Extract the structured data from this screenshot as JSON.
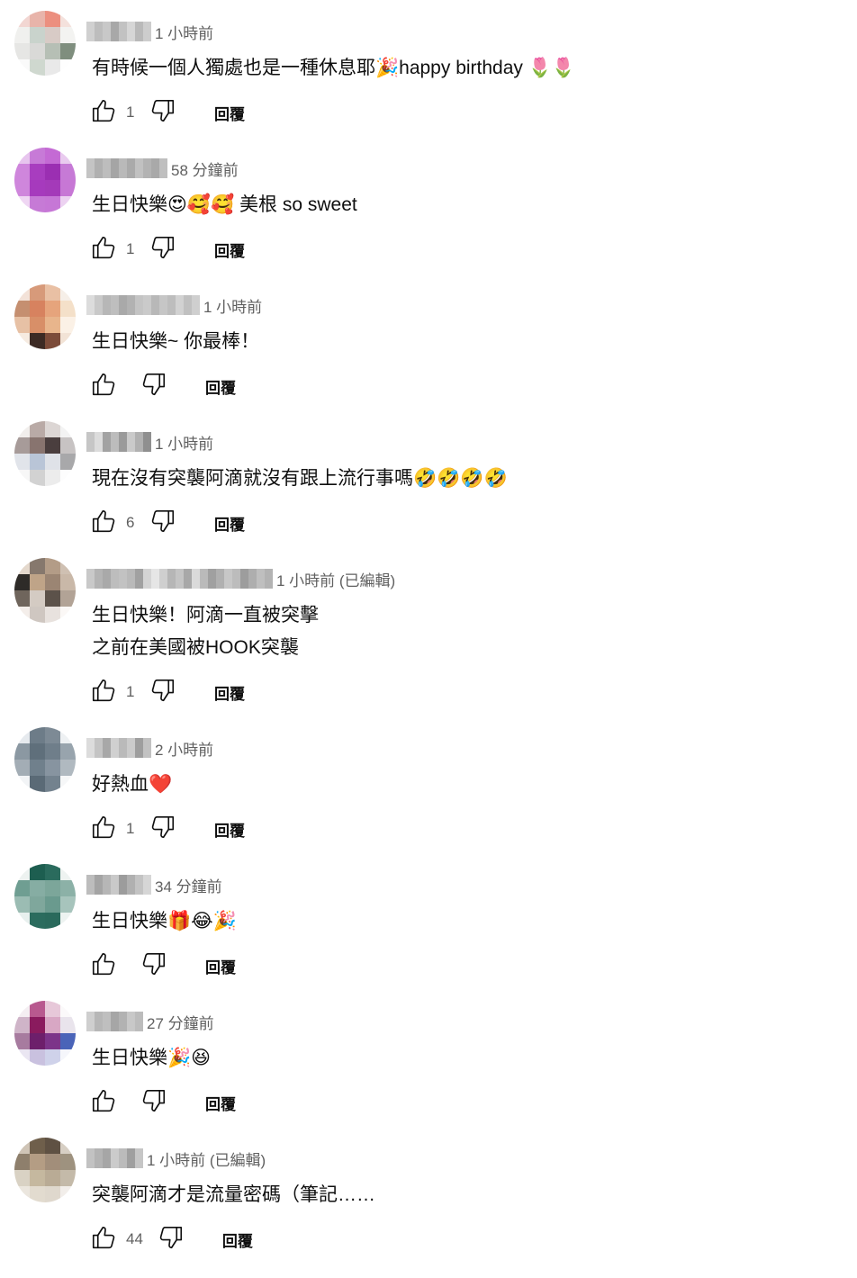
{
  "reply_label": "回覆",
  "comments": [
    {
      "time": "1 小時前",
      "text": "有時候一個人獨處也是一種休息耶🎉happy birthday 🌷🌷",
      "likes": "1",
      "avatar": [
        "#f2d6d2",
        "#e8b4aa",
        "#ec8f7f",
        "#f4e1dc",
        "#f0f0ee",
        "#c9d3cc",
        "#d8cbc6",
        "#f3f3f1",
        "#e6e6e4",
        "#d9d9d7",
        "#b6bfb5",
        "#7f8e7e",
        "#fafafa",
        "#cfd8cf",
        "#e9e9e9",
        "#fefefe"
      ],
      "name": [
        "#d0d0d0",
        "#bdbdbd",
        "#c8c8c8",
        "#a8a8a8",
        "#c2c2c2",
        "#d6d6d6",
        "#b9b9b9",
        "#cdcdcd"
      ]
    },
    {
      "time": "58 分鐘前",
      "text": "生日快樂😍🥰🥰 美根 so sweet",
      "likes": "1",
      "avatar": [
        "#e7c5ee",
        "#c77ad7",
        "#c46ad4",
        "#e9cbef",
        "#cf86dc",
        "#a83dbf",
        "#9b2fb2",
        "#c67ad6",
        "#cf86dc",
        "#a63abd",
        "#a43ab9",
        "#c777d5",
        "#efd6f3",
        "#c67ad6",
        "#c677d6",
        "#ecd2f1"
      ],
      "name": [
        "#c4c4c4",
        "#b0b0b0",
        "#bdbdbd",
        "#a5a5a5",
        "#b9b9b9",
        "#aaaaaa",
        "#c1c1c1",
        "#b3b3b3",
        "#a9a9a9",
        "#bfbfbf"
      ]
    },
    {
      "time": "1 小時前",
      "text": "生日快樂~ 你最棒！",
      "likes": "",
      "avatar": [
        "#f3e2d8",
        "#d79a7a",
        "#e9c0a4",
        "#f6efe8",
        "#c58f70",
        "#d7825f",
        "#e6a47c",
        "#f4e0c9",
        "#e7c1a5",
        "#d88f68",
        "#e8b58c",
        "#fbf1e6",
        "#f6ebe1",
        "#3c2a24",
        "#7c4b39",
        "#f2e3d6"
      ],
      "name": [
        "#dcdcdc",
        "#c9c9c9",
        "#b7b7b7",
        "#bebebe",
        "#a9a9a9",
        "#b2b2b2",
        "#c4c4c4",
        "#cacaca",
        "#b8b8b8",
        "#c6c6c6",
        "#bdbdbd",
        "#d2d2d2",
        "#c0c0c0",
        "#cfcfcf"
      ]
    },
    {
      "time": "1 小時前",
      "text": "現在沒有突襲阿滴就沒有跟上流行事嗎🤣🤣🤣🤣",
      "likes": "6",
      "avatar": [
        "#f1eeec",
        "#b9aaa6",
        "#dcd6d4",
        "#f3f3f3",
        "#a79b99",
        "#88746f",
        "#4a3e3e",
        "#c7c3c3",
        "#e1e4ea",
        "#b9c5d7",
        "#dfe2e8",
        "#a8a8aa",
        "#f7f7f7",
        "#d2d2d2",
        "#ececec",
        "#fdfdfd"
      ],
      "name": [
        "#c6c6c6",
        "#dcdcdc",
        "#a2a2a2",
        "#bcbcbc",
        "#9a9a9a",
        "#cacaca",
        "#b1b1b1",
        "#8f8f8f"
      ]
    },
    {
      "time": "1 小時前 (已編輯)",
      "text": "生日快樂！阿滴一直被突擊\n之前在美國被HOOK突襲",
      "likes": "1",
      "avatar": [
        "#e4d8cc",
        "#86786d",
        "#b39c87",
        "#cfc0b2",
        "#2e2b28",
        "#bfa488",
        "#9b8573",
        "#c9b8a8",
        "#6f655c",
        "#d4cbc3",
        "#5c524a",
        "#b2a396",
        "#f4eeea",
        "#cfc7c1",
        "#e8e2de",
        "#fbf8f6"
      ],
      "name": [
        "#c9c9c9",
        "#b4b4b4",
        "#a9a9a9",
        "#bdbdbd",
        "#c2c2c2",
        "#b9b9b9",
        "#a1a1a1",
        "#d4d4d4",
        "#e6e6e6",
        "#cfcfcf",
        "#b6b6b6",
        "#c4c4c4",
        "#a8a8a8",
        "#dadada",
        "#bababa",
        "#a0a0a0",
        "#b0b0b0",
        "#c7c7c7",
        "#bcbcbc",
        "#9d9d9d",
        "#aeaeae",
        "#bfbfbf",
        "#b3b3b3"
      ]
    },
    {
      "time": "2 小時前",
      "text": "好熱血❤️",
      "likes": "1",
      "avatar": [
        "#e6eaee",
        "#6d7c88",
        "#7d8a95",
        "#eef1f3",
        "#8b98a2",
        "#5f6f7b",
        "#6f7e8a",
        "#98a4ad",
        "#a3adb5",
        "#70808c",
        "#8794a0",
        "#b0b9c0",
        "#f2f4f6",
        "#5a6a76",
        "#73828e",
        "#f6f7f8"
      ],
      "name": [
        "#dcdcdc",
        "#c4c4c4",
        "#a8a8a8",
        "#d0d0d0",
        "#bababa",
        "#cbcbcb",
        "#9e9e9e",
        "#c2c2c2"
      ]
    },
    {
      "time": "34 分鐘前",
      "text": "生日快樂🎁😂🎉",
      "likes": "",
      "avatar": [
        "#edf2f0",
        "#1d5e50",
        "#2a6b5d",
        "#eef3f1",
        "#6f9e92",
        "#86ada3",
        "#7ca69a",
        "#8cb1a7",
        "#9bbcb3",
        "#7fa79c",
        "#6a9a8e",
        "#a7c4bc",
        "#e8f0ee",
        "#2b6c5e",
        "#2a6a5c",
        "#edf3f1"
      ],
      "name": [
        "#bdbdbd",
        "#a4a4a4",
        "#b6b6b6",
        "#c9c9c9",
        "#9c9c9c",
        "#b0b0b0",
        "#c3c3c3",
        "#d6d6d6"
      ]
    },
    {
      "time": "27 分鐘前",
      "text": "生日快樂🎉😆",
      "likes": "",
      "avatar": [
        "#f4eef2",
        "#b8598f",
        "#e7c8d9",
        "#fbf9fa",
        "#cfb4c8",
        "#8a1b5e",
        "#d8a7c4",
        "#e9e4ec",
        "#a77b9f",
        "#6d1f6b",
        "#7c3489",
        "#4a64b8",
        "#eae6f2",
        "#c9c1df",
        "#cfd2ea",
        "#f5f6fb"
      ],
      "name": [
        "#cfcfcf",
        "#b7b7b7",
        "#bfbfbf",
        "#a6a6a6",
        "#b2b2b2",
        "#c8c8c8",
        "#bcbcbc"
      ]
    },
    {
      "time": "1 小時前 (已編輯)",
      "text": "突襲阿滴才是流量密碼（筆記……",
      "likes": "44",
      "avatar": [
        "#cfc4b6",
        "#6f5f4b",
        "#5f5143",
        "#d7cfc4",
        "#8e7f6c",
        "#b49d84",
        "#a28e7a",
        "#9e927f",
        "#d9d2c4",
        "#c5b89f",
        "#b9ab95",
        "#c4baa9",
        "#ebe6de",
        "#e2dbcf",
        "#dfd8cd",
        "#f2eeea"
      ],
      "name": [
        "#c2c2c2",
        "#b3b3b3",
        "#a6a6a6",
        "#cbcbcb",
        "#bbbbbb",
        "#9f9f9f",
        "#c6c6c6"
      ]
    }
  ]
}
